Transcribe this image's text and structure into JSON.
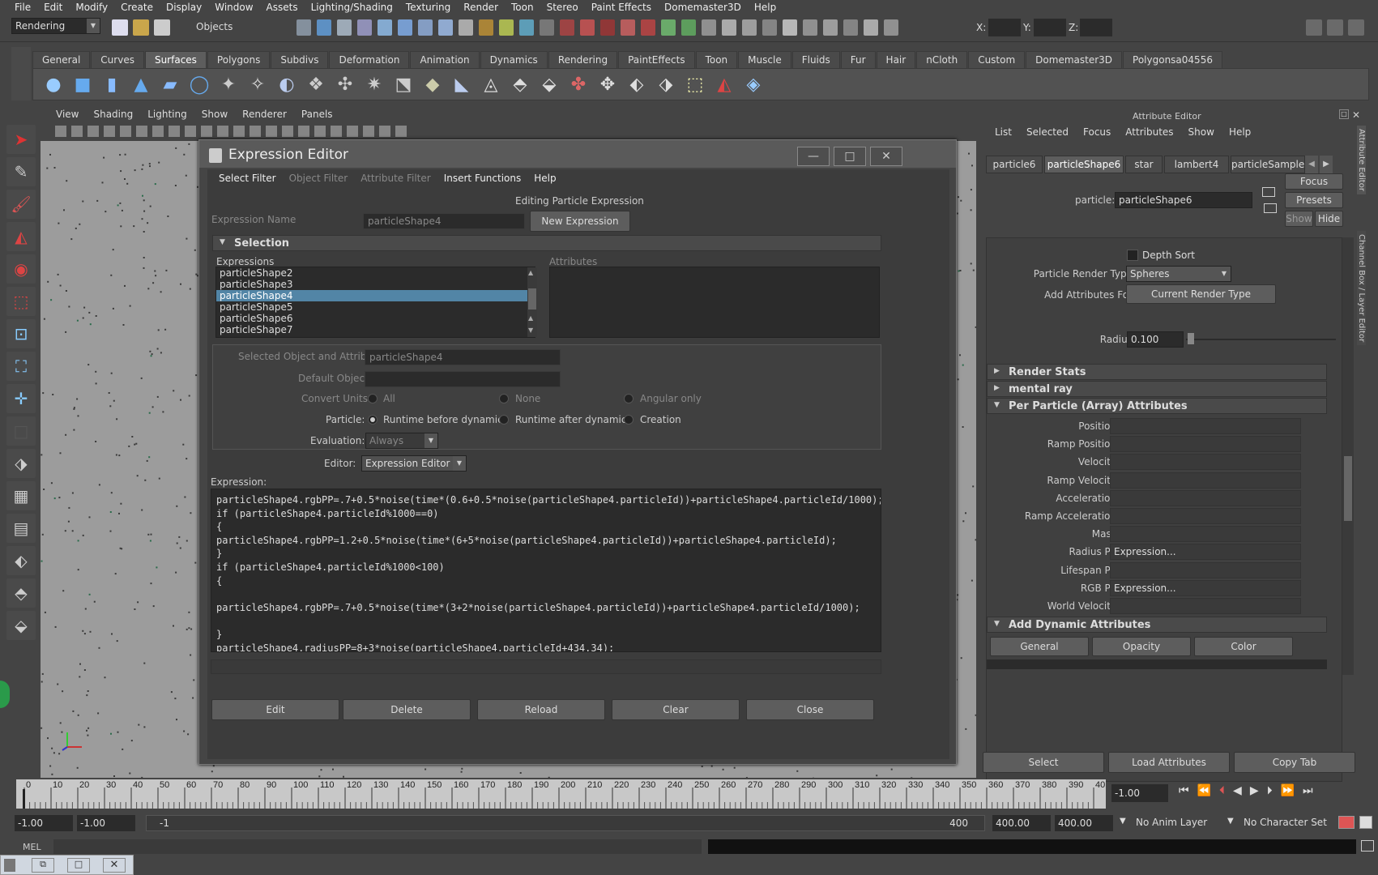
{
  "menubar": [
    "File",
    "Edit",
    "Modify",
    "Create",
    "Display",
    "Window",
    "Assets",
    "Lighting/Shading",
    "Texturing",
    "Render",
    "Toon",
    "Stereo",
    "Paint Effects",
    "Domemaster3D",
    "Help"
  ],
  "status": {
    "mode": "Rendering",
    "filter": "Objects",
    "x_label": "X:",
    "y_label": "Y:",
    "z_label": "Z:"
  },
  "shelf_tabs": [
    "General",
    "Curves",
    "Surfaces",
    "Polygons",
    "Subdivs",
    "Deformation",
    "Animation",
    "Dynamics",
    "Rendering",
    "PaintEffects",
    "Toon",
    "Muscle",
    "Fluids",
    "Fur",
    "Hair",
    "nCloth",
    "Custom",
    "Domemaster3D",
    "Polygonsa04556"
  ],
  "viewport_menu": [
    "View",
    "Shading",
    "Lighting",
    "Show",
    "Renderer",
    "Panels"
  ],
  "dialog": {
    "title": "Expression Editor",
    "menu": [
      {
        "t": "Select Filter",
        "dis": false
      },
      {
        "t": "Object Filter",
        "dis": true
      },
      {
        "t": "Attribute Filter",
        "dis": true
      },
      {
        "t": "Insert Functions",
        "dis": false
      },
      {
        "t": "Help",
        "dis": false
      }
    ],
    "heading": "Editing Particle Expression",
    "expr_name_label": "Expression Name",
    "expr_name_value": "particleShape4",
    "new_expression": "New Expression",
    "selection": "Selection",
    "expressions_label": "Expressions",
    "attributes_label": "Attributes",
    "expressions": [
      "particleShape2",
      "particleShape3",
      "particleShape4",
      "particleShape5",
      "particleShape6",
      "particleShape7"
    ],
    "selected_index": 2,
    "sel_obj_label": "Selected Object and Attribute:",
    "sel_obj_value": "particleShape4",
    "default_obj_label": "Default Object:",
    "convert_units_label": "Convert Units:",
    "units": [
      "All",
      "None",
      "Angular only"
    ],
    "particle_label": "Particle:",
    "particle_opts": [
      "Runtime before dynamics",
      "Runtime after dynamics",
      "Creation"
    ],
    "evaluation_label": "Evaluation:",
    "evaluation_value": "Always",
    "editor_label": "Editor:",
    "editor_value": "Expression Editor",
    "expression_label": "Expression:",
    "code": "particleShape4.rgbPP=.7+0.5*noise(time*(0.6+0.5*noise(particleShape4.particleId))+particleShape4.particleId/1000);\nif (particleShape4.particleId%1000==0)\n{\nparticleShape4.rgbPP=1.2+0.5*noise(time*(6+5*noise(particleShape4.particleId))+particleShape4.particleId);\n}\nif (particleShape4.particleId%1000<100)\n{\n\nparticleShape4.rgbPP=.7+0.5*noise(time*(3+2*noise(particleShape4.particleId))+particleShape4.particleId/1000);\n\n}\nparticleShape4.radiusPP=8+3*noise(particleShape4.particleId+434.34);",
    "buttons": [
      "Edit",
      "Delete",
      "Reload",
      "Clear",
      "Close"
    ]
  },
  "attr": {
    "title": "Attribute Editor",
    "menu": [
      "List",
      "Selected",
      "Focus",
      "Attributes",
      "Show",
      "Help"
    ],
    "tabs": [
      "particle6",
      "particleShape6",
      "star",
      "lambert4",
      "particleSampler"
    ],
    "particle_label": "particle:",
    "particle_value": "particleShape6",
    "focus": "Focus",
    "presets": "Presets",
    "show": "Show",
    "hide": "Hide",
    "depth_sort": "Depth Sort",
    "render_type_label": "Particle Render Type",
    "render_type_value": "Spheres",
    "add_attrs_label": "Add Attributes For",
    "add_attrs_btn": "Current Render Type",
    "radius_label": "Radius",
    "radius_value": "0.100",
    "render_stats": "Render Stats",
    "mental_ray": "mental ray",
    "per_particle": "Per Particle (Array) Attributes",
    "pp_rows": [
      {
        "l": "Position",
        "v": ""
      },
      {
        "l": "Ramp Position",
        "v": ""
      },
      {
        "l": "Velocity",
        "v": ""
      },
      {
        "l": "Ramp Velocity",
        "v": ""
      },
      {
        "l": "Acceleration",
        "v": ""
      },
      {
        "l": "Ramp Acceleration",
        "v": ""
      },
      {
        "l": "Mass",
        "v": ""
      },
      {
        "l": "Radius PP",
        "v": "Expression..."
      },
      {
        "l": "Lifespan PP",
        "v": ""
      },
      {
        "l": "RGB PP",
        "v": "Expression..."
      },
      {
        "l": "World Velocity",
        "v": ""
      }
    ],
    "add_dynamic": "Add Dynamic Attributes",
    "dyn_buttons": [
      "General",
      "Opacity",
      "Color"
    ],
    "bottom_buttons": [
      "Select",
      "Load Attributes",
      "Copy Tab"
    ],
    "side_tabs": [
      "Attribute Editor",
      "Channel Box / Layer Editor"
    ]
  },
  "timeline": {
    "ticks": [
      "0",
      "10",
      "20",
      "30",
      "40",
      "50",
      "60",
      "70",
      "80",
      "90",
      "100",
      "110",
      "120",
      "130",
      "140",
      "150",
      "160",
      "170",
      "180",
      "190",
      "200",
      "210",
      "220",
      "230",
      "240",
      "250",
      "260",
      "270",
      "280",
      "290",
      "300",
      "310",
      "320",
      "330",
      "340",
      "350",
      "360",
      "370",
      "380",
      "390",
      "40"
    ],
    "current": "-1.00"
  },
  "range": {
    "start": "-1.00",
    "start2": "-1.00",
    "inner_start": "-1",
    "inner_end": "400",
    "end": "400.00",
    "end2": "400.00",
    "anim_layer": "No Anim Layer",
    "char_set": "No Character Set"
  },
  "cmd": {
    "label": "MEL"
  },
  "colors": {
    "accent": "#5285a6",
    "panel": "#444444",
    "field": "#2b2b2b"
  }
}
